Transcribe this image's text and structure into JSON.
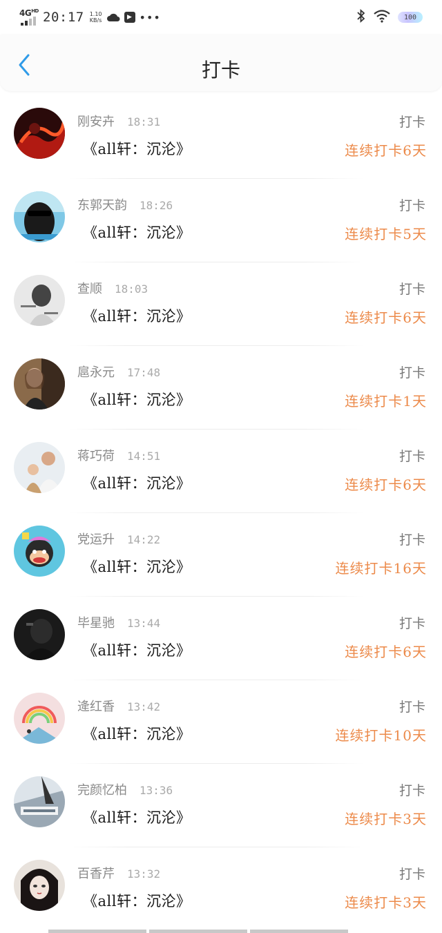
{
  "status_bar": {
    "network": "4G",
    "network_sup": "HD",
    "time": "20:17",
    "speed_value": "1.10",
    "speed_unit": "KB/s",
    "battery": "100"
  },
  "header": {
    "title": "打卡"
  },
  "entries": [
    {
      "name": "刚安卉",
      "time": "18:31",
      "book": "《all轩：沉沦》",
      "action": "打卡",
      "streak": "连续打卡6天",
      "avatar_style": "fire"
    },
    {
      "name": "东郭天韵",
      "time": "18:26",
      "book": "《all轩：沉沦》",
      "action": "打卡",
      "streak": "连续打卡5天",
      "avatar_style": "sunglasses"
    },
    {
      "name": "查顺",
      "time": "18:03",
      "book": "《all轩：沉沦》",
      "action": "打卡",
      "streak": "连续打卡6天",
      "avatar_style": "mono"
    },
    {
      "name": "扈永元",
      "time": "17:48",
      "book": "《all轩：沉沦》",
      "action": "打卡",
      "streak": "连续打卡1天",
      "avatar_style": "girl"
    },
    {
      "name": "蒋巧荷",
      "time": "14:51",
      "book": "《all轩：沉沦》",
      "action": "打卡",
      "streak": "连续打卡6天",
      "avatar_style": "family"
    },
    {
      "name": "党运升",
      "time": "14:22",
      "book": "《all轩：沉沦》",
      "action": "打卡",
      "streak": "连续打卡16天",
      "avatar_style": "monkey"
    },
    {
      "name": "毕星驰",
      "time": "13:44",
      "book": "《all轩：沉沦》",
      "action": "打卡",
      "streak": "连续打卡6天",
      "avatar_style": "dark"
    },
    {
      "name": "逄红香",
      "time": "13:42",
      "book": "《all轩：沉沦》",
      "action": "打卡",
      "streak": "连续打卡10天",
      "avatar_style": "rainbow"
    },
    {
      "name": "完颜忆柏",
      "time": "13:36",
      "book": "《all轩：沉沦》",
      "action": "打卡",
      "streak": "连续打卡3天",
      "avatar_style": "text"
    },
    {
      "name": "百香芹",
      "time": "13:32",
      "book": "《all轩：沉沦》",
      "action": "打卡",
      "streak": "连续打卡3天",
      "avatar_style": "anime"
    }
  ],
  "colors": {
    "accent_back": "#2f9be8",
    "streak": "#ec8a4a",
    "name": "#8a8a8a"
  }
}
